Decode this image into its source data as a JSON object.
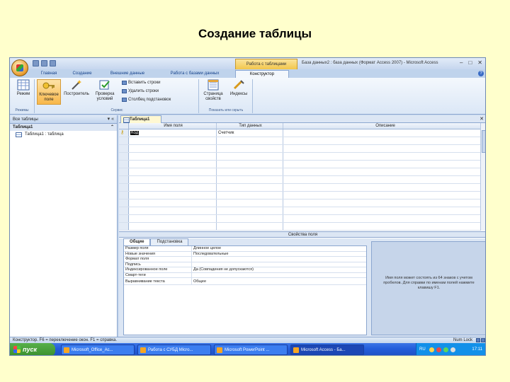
{
  "slide": {
    "title": "Создание таблицы"
  },
  "window": {
    "context_tab_title": "Работа с таблицами",
    "title": "База данных2 : база данных (Формат Access 2007) - Microsoft Access",
    "controls": {
      "minimize": "–",
      "maximize": "□",
      "close": "✕"
    }
  },
  "ribbon_tabs": [
    "Главная",
    "Создание",
    "Внешние данные",
    "Работа с базами данных",
    "Конструктор"
  ],
  "ribbon": {
    "buttons": {
      "view": "Режим",
      "key_field": "Ключевое поле",
      "builder": "Построитель",
      "test_rules": "Проверка условий",
      "property_sheet": "Страница свойств",
      "indexes": "Индексы"
    },
    "small_commands": [
      "Вставить строки",
      "Удалить строки",
      "Столбец подстановок"
    ],
    "groups": [
      "Режимы",
      "Сервис",
      "Показать или скрыть"
    ]
  },
  "nav": {
    "header": "Все таблицы",
    "group": "Таблица1",
    "items": [
      "Таблица1 : таблица"
    ]
  },
  "document": {
    "tab": "Таблица1",
    "columns": [
      "Имя поля",
      "Тип данных",
      "Описание"
    ],
    "rows": [
      {
        "name": "Код",
        "type": "Счетчик",
        "desc": ""
      }
    ]
  },
  "properties": {
    "section_label": "Свойства поля",
    "tabs": [
      "Общие",
      "Подстановка"
    ],
    "rows": [
      {
        "key": "Размер поля",
        "value": "Длинное целое"
      },
      {
        "key": "Новые значения",
        "value": "Последовательные"
      },
      {
        "key": "Формат поля",
        "value": ""
      },
      {
        "key": "Подпись",
        "value": ""
      },
      {
        "key": "Индексированное поле",
        "value": "Да (Совпадения не допускаются)"
      },
      {
        "key": "Смарт-теги",
        "value": ""
      },
      {
        "key": "Выравнивание текста",
        "value": "Общее"
      }
    ],
    "help": "Имя поля может состоять из 64 знаков с учетом пробелов. Для справки по именам полей нажмите клавишу F1."
  },
  "status": {
    "left": "Конструктор. F6 = переключение окон. F1 = справка.",
    "right": "Num Lock"
  },
  "taskbar": {
    "start": "пуск",
    "tasks": [
      "Microsoft_Office_Ac...",
      "Работа с СУБД Micro...",
      "Microsoft PowerPoint ...",
      "Microsoft Access - Ба..."
    ],
    "lang": "RU",
    "clock": "17:11"
  }
}
